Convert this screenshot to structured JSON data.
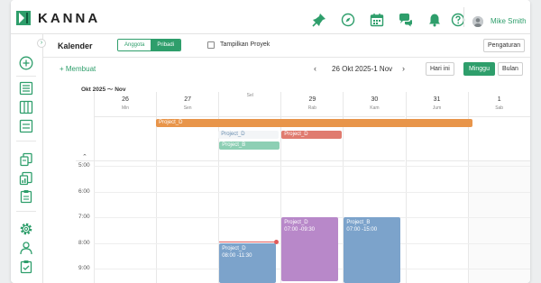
{
  "app": {
    "brand": "KANNA",
    "user_name": "Mike Smith"
  },
  "colors": {
    "accent": "#2e9e6b",
    "orange": "#e8954a",
    "red": "#e07b6f",
    "teal": "#8dcfb4",
    "purple": "#b888c9",
    "blue": "#7ca3cb"
  },
  "header_icons": [
    "pin-icon",
    "compass-icon",
    "calendar-icon",
    "chat-icon",
    "bell-icon",
    "help-icon"
  ],
  "sidebar_icons": [
    "add-circle-icon",
    "list-icon",
    "columns-icon",
    "folder-icon",
    "documents-icon",
    "chart-icon",
    "clipboard-icon",
    "settings-icon",
    "user-icon",
    "checklist-icon"
  ],
  "page": {
    "title": "Kalender",
    "tab_member": "Anggota",
    "tab_personal": "Pribadi",
    "show_projects_label": "Tampilkan Proyek",
    "settings_button": "Pengaturan"
  },
  "toolbar": {
    "create_label": "+ Membuat",
    "prev": "‹",
    "date_range": "26 Okt 2025-1 Nov",
    "next": "›",
    "today": "Hari ini",
    "week": "Minggu",
    "month": "Bulan"
  },
  "calendar": {
    "month_label": "Okt 2025 ～ Nov",
    "collapse_caret": "⌃",
    "days": [
      {
        "num": "26",
        "wd": "Min"
      },
      {
        "num": "27",
        "wd": "Sen"
      },
      {
        "num": "28",
        "wd": "Sel"
      },
      {
        "num": "29",
        "wd": "Rab"
      },
      {
        "num": "30",
        "wd": "Kam"
      },
      {
        "num": "31",
        "wd": "Jum"
      },
      {
        "num": "1",
        "wd": "Sab"
      }
    ],
    "times": [
      "5:00",
      "6:00",
      "7:00",
      "8:00",
      "9:00"
    ],
    "allday": [
      {
        "label": "Project_D"
      },
      {
        "label": "Project_D"
      },
      {
        "label": "Project_D"
      },
      {
        "label": "Project_B"
      }
    ],
    "events": [
      {
        "title": "Project_D",
        "time": "07:00 -09:30"
      },
      {
        "title": "Project_B",
        "time": "07:00 -15:00"
      },
      {
        "title": "Project_D",
        "time": "08:00 -11:30"
      }
    ]
  }
}
